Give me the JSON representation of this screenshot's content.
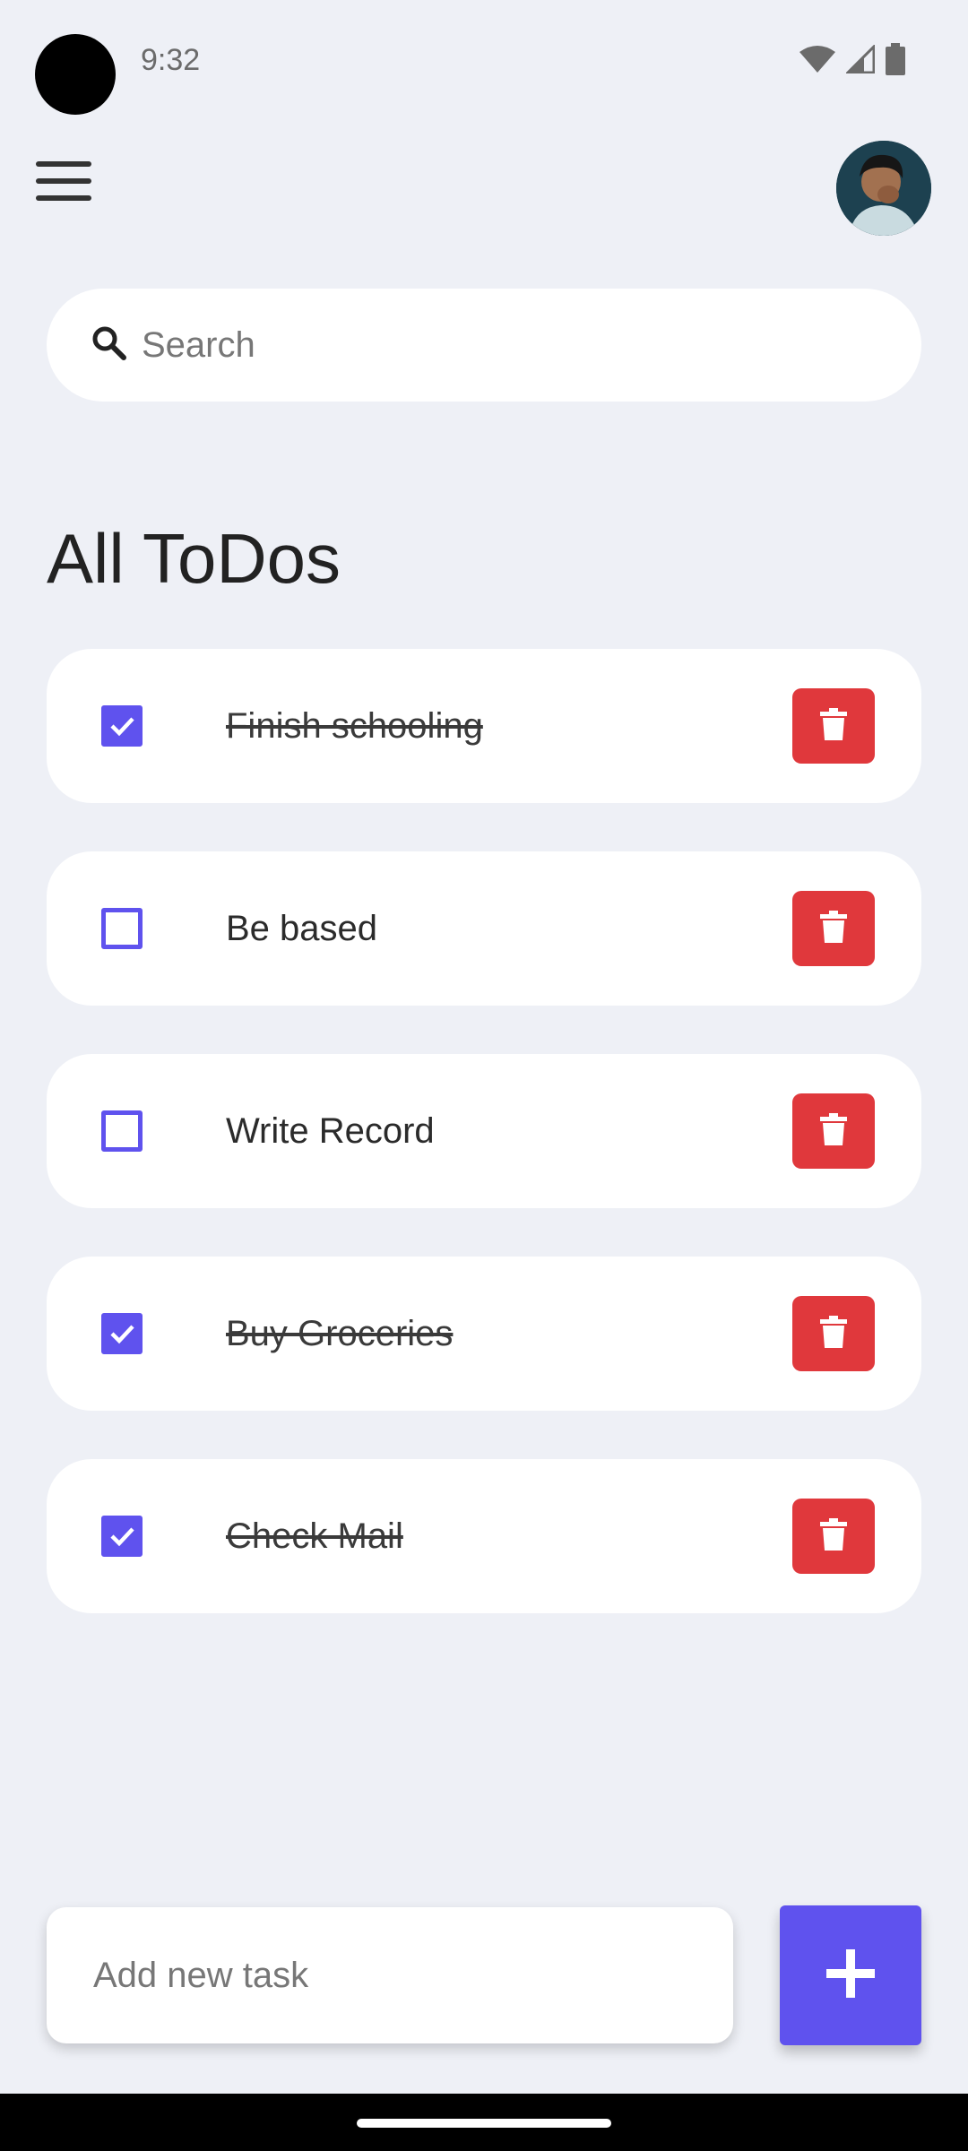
{
  "status_bar": {
    "time": "9:32",
    "icons": [
      "wifi-icon",
      "signal-icon",
      "battery-icon"
    ]
  },
  "header": {
    "menu_icon": "hamburger-menu-icon",
    "avatar": "user-avatar"
  },
  "search": {
    "placeholder": "Search",
    "value": ""
  },
  "title": "All ToDos",
  "todos": [
    {
      "text": "Finish schooling",
      "done": true
    },
    {
      "text": "Be based",
      "done": false
    },
    {
      "text": "Write Record",
      "done": false
    },
    {
      "text": "Buy Groceries",
      "done": true
    },
    {
      "text": "Check Mail",
      "done": true
    }
  ],
  "add_task": {
    "placeholder": "Add new task",
    "value": "",
    "button_icon": "plus-icon"
  },
  "colors": {
    "accent": "#5f52ee",
    "danger": "#e0383c",
    "background": "#eef0f6",
    "card": "#ffffff"
  }
}
